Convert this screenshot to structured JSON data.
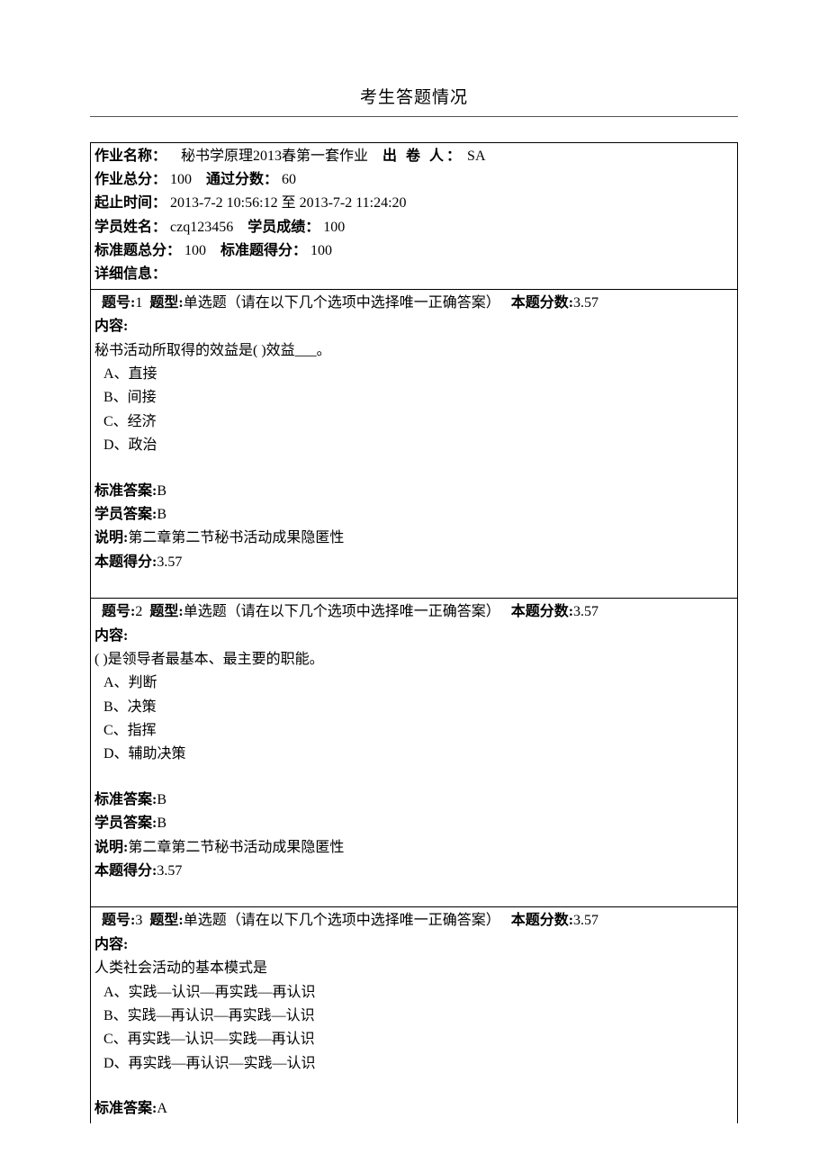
{
  "page": {
    "title": "考生答题情况"
  },
  "header": {
    "labels": {
      "assignment_name": "作业名称：",
      "issuer": "出 卷 人：",
      "total_score": "作业总分：",
      "pass_score": "通过分数：",
      "period": "起止时间：",
      "student_name": "学员姓名：",
      "student_score": "学员成绩：",
      "std_total": "标准题总分：",
      "std_got": "标准题得分：",
      "detail": "详细信息："
    },
    "values": {
      "assignment_name": "秘书学原理2013春第一套作业",
      "issuer": "SA",
      "total_score": "100",
      "pass_score": "60",
      "period": "2013-7-2 10:56:12 至 2013-7-2 11:24:20",
      "student_name": "czq123456",
      "student_score": "100",
      "std_total": "100",
      "std_got": "100"
    }
  },
  "q_labels": {
    "qno": "题号:",
    "qtype": "题型:",
    "qscore": "本题分数:",
    "content": "内容:",
    "std_ans": "标准答案:",
    "stu_ans": "学员答案:",
    "explain": "说明:",
    "got": "本题得分:"
  },
  "questions": [
    {
      "no": "1",
      "type": "单选题（请在以下几个选项中选择唯一正确答案）",
      "score": "3.57",
      "stem": "秘书活动所取得的效益是( )效益___。",
      "options": [
        "A、直接",
        "B、间接",
        "C、经济",
        "D、政治"
      ],
      "std_ans": "B",
      "stu_ans": "B",
      "explain": "第二章第二节秘书活动成果隐匿性",
      "got": "3.57",
      "show_footer": true
    },
    {
      "no": "2",
      "type": "单选题（请在以下几个选项中选择唯一正确答案）",
      "score": "3.57",
      "stem": "( )是领导者最基本、最主要的职能。",
      "options": [
        "A、判断",
        "B、决策",
        "C、指挥",
        "D、辅助决策"
      ],
      "std_ans": "B",
      "stu_ans": "B",
      "explain": "第二章第二节秘书活动成果隐匿性",
      "got": "3.57",
      "show_footer": true
    },
    {
      "no": "3",
      "type": "单选题（请在以下几个选项中选择唯一正确答案）",
      "score": "3.57",
      "stem": "人类社会活动的基本模式是",
      "options": [
        "A、实践—认识—再实践—再认识",
        "B、实践—再认识—再实践—认识",
        "C、再实践—认识—实践—再认识",
        "D、再实践—再认识—实践—认识"
      ],
      "std_ans": "A",
      "stu_ans": "",
      "explain": "",
      "got": "",
      "show_footer": false
    }
  ]
}
